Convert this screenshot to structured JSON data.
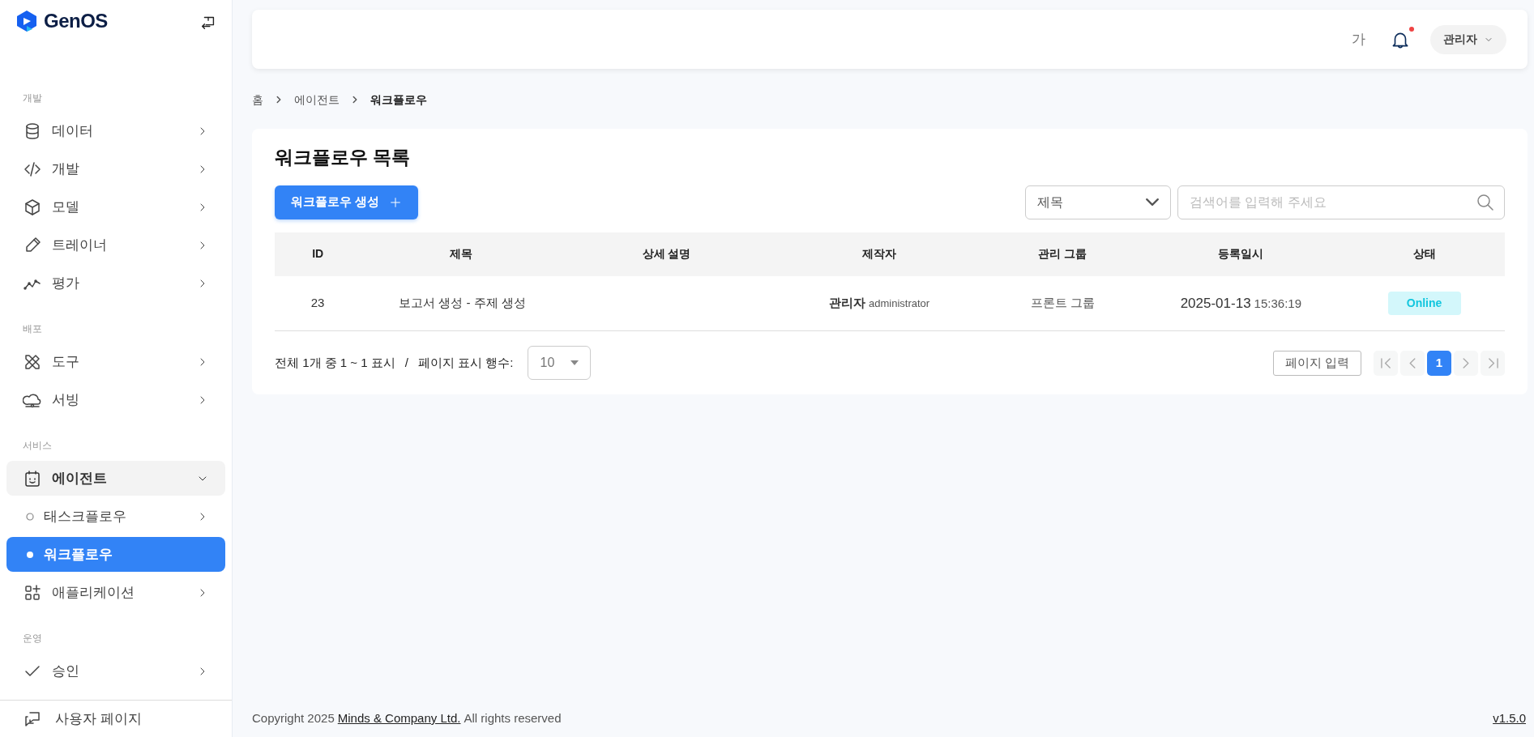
{
  "sidebar": {
    "logo": "GenOS",
    "sections": [
      {
        "label": "개발",
        "items": [
          {
            "label": "데이터",
            "expanded": false
          },
          {
            "label": "개발",
            "expanded": false
          },
          {
            "label": "모델",
            "expanded": false
          },
          {
            "label": "트레이너",
            "expanded": false
          },
          {
            "label": "평가",
            "expanded": false
          }
        ]
      },
      {
        "label": "배포",
        "items": [
          {
            "label": "도구",
            "expanded": false
          },
          {
            "label": "서빙",
            "expanded": false
          }
        ]
      },
      {
        "label": "서비스",
        "items": [
          {
            "label": "에이전트",
            "expanded": true,
            "children": [
              {
                "label": "태스크플로우",
                "selected": false
              },
              {
                "label": "워크플로우",
                "selected": true
              }
            ]
          },
          {
            "label": "애플리케이션",
            "expanded": false
          }
        ]
      },
      {
        "label": "운영",
        "items": [
          {
            "label": "승인",
            "expanded": false
          }
        ]
      }
    ],
    "footer": "사용자 페이지"
  },
  "header": {
    "font_button": "가",
    "has_notifications": true,
    "user": "관리자"
  },
  "breadcrumb": [
    "홈",
    "에이전트",
    "워크플로우"
  ],
  "page": {
    "title": "워크플로우 목록",
    "create_button": "워크플로우 생성",
    "filter": "제목",
    "search": {
      "placeholder": "검색어를 입력해 주세요"
    },
    "table": {
      "columns": [
        "ID",
        "제목",
        "상세 설명",
        "제작자",
        "관리 그룹",
        "등록일시",
        "상태"
      ],
      "rows": [
        {
          "id": "23",
          "title": "보고서 생성 - 주제 생성",
          "creator": "관리자",
          "creator_id": "administrator",
          "group": "프론트 그룹",
          "date": "2025-01-13",
          "time": "15:36:19",
          "status": "Online"
        }
      ]
    },
    "summary": "전체 1개 중 1 ~ 1 표시",
    "separator": "/",
    "page_size_label": "페이지 표시 행수:",
    "page_size": "10",
    "page_input": "페이지 입력",
    "pages": [
      {
        "label": "1",
        "selected": true
      }
    ]
  },
  "footer": {
    "copyright": "Copyright 2025",
    "company": "Minds & Company Ltd.",
    "rights": "All rights reserved",
    "version": "v1.5.0"
  }
}
